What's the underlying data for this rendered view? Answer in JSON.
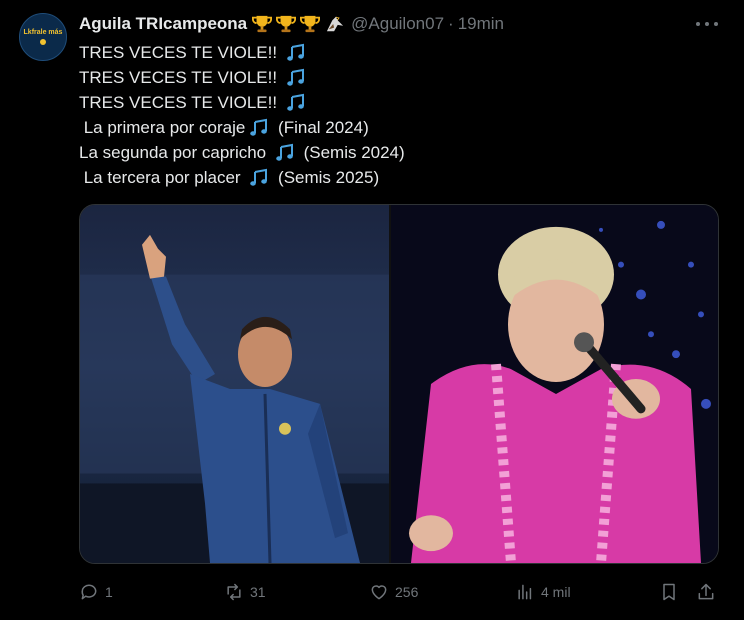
{
  "post": {
    "avatar_text": "Lkfrale más",
    "display_name": "Aguila TRIcampeona",
    "badges": [
      "trophy-icon",
      "trophy-icon",
      "trophy-icon",
      "eagle-icon"
    ],
    "handle": "@Aguilon07",
    "separator": "·",
    "time": "19min",
    "lines": [
      {
        "before": "TRES VECES TE VIOLE!! ",
        "after": ""
      },
      {
        "before": "TRES VECES TE VIOLE!! ",
        "after": ""
      },
      {
        "before": "TRES VECES TE VIOLE!! ",
        "after": ""
      },
      {
        "before": " La primera por coraje",
        "after": " (Final 2024)"
      },
      {
        "before": "La segunda por capricho ",
        "after": " (Semis 2024)"
      },
      {
        "before": " La tercera por placer ",
        "after": " (Semis 2025)"
      }
    ],
    "media": {
      "left_photo": "man-in-blue-jacket-raising-hand",
      "right_photo": "singer-in-pink-dress-with-microphone"
    }
  },
  "actions": {
    "replies": "1",
    "reposts": "31",
    "likes": "256",
    "views": "4 mil"
  },
  "colors": {
    "background": "#000000",
    "text": "#e7e9ea",
    "muted": "#71767b",
    "note_blue": "#4aa3df",
    "trophy_gold": "#f2b51c"
  }
}
